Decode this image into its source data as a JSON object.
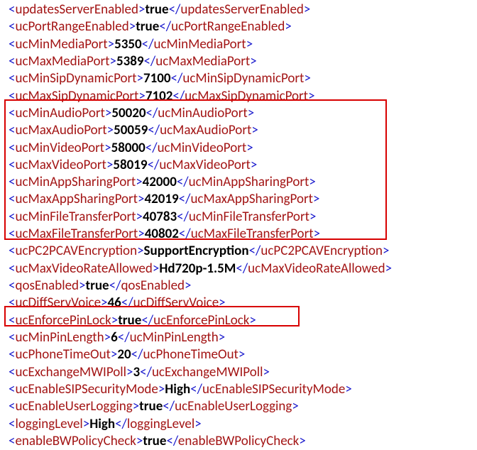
{
  "entries": [
    {
      "tag": "updatesServerEnabled",
      "value": "true"
    },
    {
      "tag": "ucPortRangeEnabled",
      "value": "true"
    },
    {
      "tag": "ucMinMediaPort",
      "value": "5350"
    },
    {
      "tag": "ucMaxMediaPort",
      "value": "5389"
    },
    {
      "tag": "ucMinSipDynamicPort",
      "value": "7100"
    },
    {
      "tag": "ucMaxSipDynamicPort",
      "value": "7102"
    },
    {
      "tag": "ucMinAudioPort",
      "value": "50020"
    },
    {
      "tag": "ucMaxAudioPort",
      "value": "50059"
    },
    {
      "tag": "ucMinVideoPort",
      "value": "58000"
    },
    {
      "tag": "ucMaxVideoPort",
      "value": "58019"
    },
    {
      "tag": "ucMinAppSharingPort",
      "value": "42000"
    },
    {
      "tag": "ucMaxAppSharingPort",
      "value": "42019"
    },
    {
      "tag": "ucMinFileTransferPort",
      "value": "40783"
    },
    {
      "tag": "ucMaxFileTransferPort",
      "value": "40802"
    },
    {
      "tag": "ucPC2PCAVEncryption",
      "value": "SupportEncryption"
    },
    {
      "tag": "ucMaxVideoRateAllowed",
      "value": "Hd720p-1.5M"
    },
    {
      "tag": "qosEnabled",
      "value": "true"
    },
    {
      "tag": "ucDiffServVoice",
      "value": "46"
    },
    {
      "tag": "ucEnforcePinLock",
      "value": "true"
    },
    {
      "tag": "ucMinPinLength",
      "value": "6"
    },
    {
      "tag": "ucPhoneTimeOut",
      "value": "20"
    },
    {
      "tag": "ucExchangeMWIPoll",
      "value": "3"
    },
    {
      "tag": "ucEnableSIPSecurityMode",
      "value": "High"
    },
    {
      "tag": "ucEnableUserLogging",
      "value": "true"
    },
    {
      "tag": "loggingLevel",
      "value": "High"
    },
    {
      "tag": "enableBWPolicyCheck",
      "value": "true"
    }
  ]
}
